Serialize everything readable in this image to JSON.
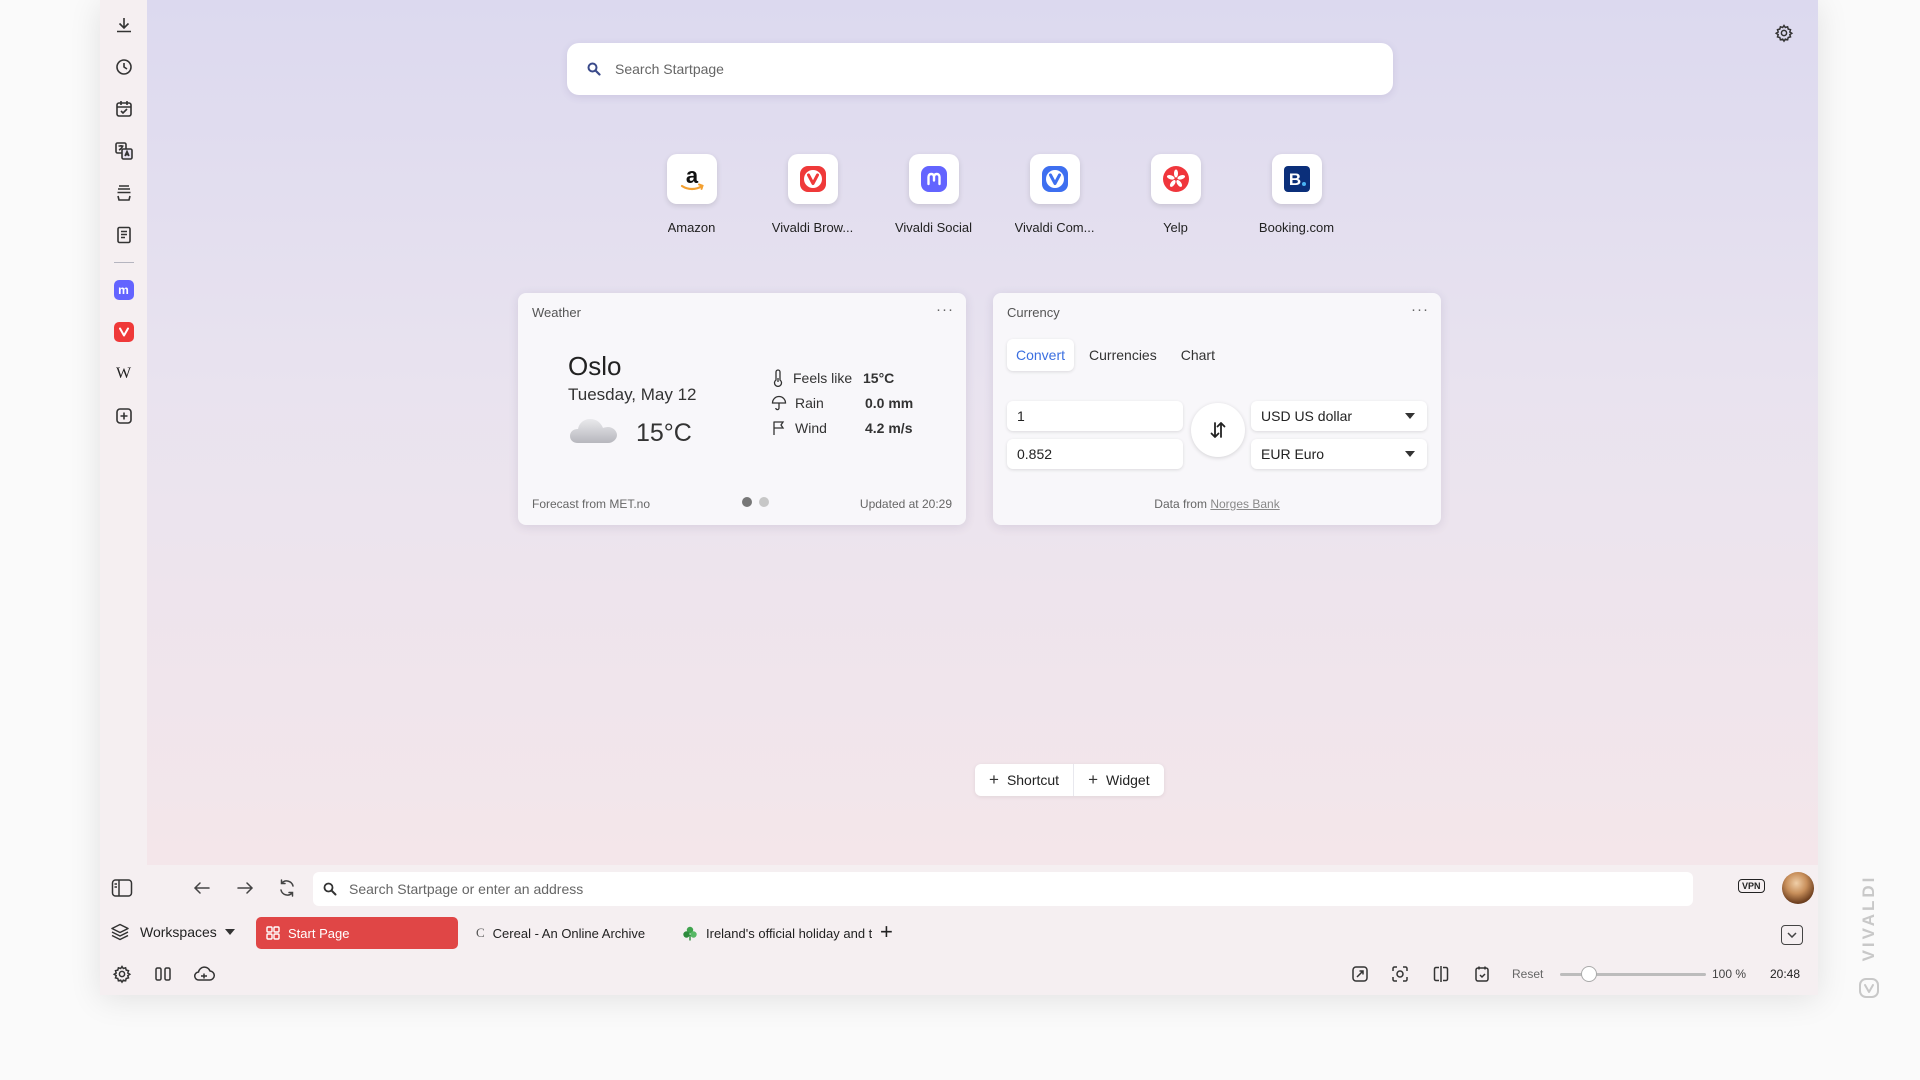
{
  "startpage": {
    "search_placeholder": "Search Startpage",
    "speed_dials": [
      {
        "label": "Amazon",
        "icon": "amazon-icon"
      },
      {
        "label": "Vivaldi Brow...",
        "icon": "vivaldi-icon"
      },
      {
        "label": "Vivaldi Social",
        "icon": "mastodon-icon"
      },
      {
        "label": "Vivaldi Com...",
        "icon": "vivaldi-community-icon"
      },
      {
        "label": "Yelp",
        "icon": "yelp-icon"
      },
      {
        "label": "Booking.com",
        "icon": "booking-icon"
      }
    ],
    "add_shortcut_label": "Shortcut",
    "add_widget_label": "Widget"
  },
  "weather": {
    "title": "Weather",
    "menu": "···",
    "city": "Oslo",
    "date": "Tuesday, May 12",
    "temperature": "15°C",
    "feels_like_label": "Feels like",
    "feels_like_value": "15°C",
    "rain_label": "Rain",
    "rain_value": "0.0 mm",
    "wind_label": "Wind",
    "wind_value": "4.2 m/s",
    "footer_source": "Forecast from MET.no",
    "footer_updated": "Updated at 20:29"
  },
  "currency": {
    "title": "Currency",
    "menu": "···",
    "tabs": [
      "Convert",
      "Currencies",
      "Chart"
    ],
    "amount_from": "1",
    "amount_to": "0.852",
    "currency_from": "USD US dollar",
    "currency_to": "EUR Euro",
    "data_from_prefix": "Data from",
    "data_from_link": "Norges Bank"
  },
  "toolbar": {
    "address_placeholder": "Search Startpage or enter an address",
    "vpn_label": "VPN"
  },
  "tabbar": {
    "workspaces_label": "Workspaces",
    "tabs": [
      {
        "title": "Start Page",
        "active": true
      },
      {
        "title": "Cereal - An Online Archive",
        "active": false
      },
      {
        "title": "Ireland's official holiday and travel guide",
        "active": false
      }
    ],
    "new_tab": "+"
  },
  "statusbar": {
    "zoom_reset_label": "Reset",
    "zoom_level": "100 %",
    "zoom_fraction": 0.2,
    "clock": "20:48"
  },
  "brand": {
    "wordmark": "VIVALDI"
  },
  "colors": {
    "accent": "#e04646",
    "link_blue": "#3b6fe0",
    "mastodon": "#6364ff",
    "vivaldi_red": "#ef3939"
  }
}
